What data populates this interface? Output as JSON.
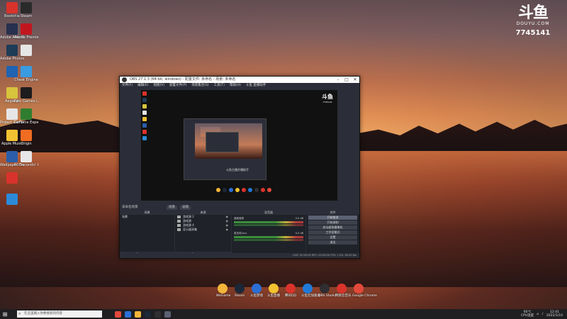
{
  "desktop": {
    "icons": [
      {
        "label": "Bootchia",
        "color": "#d9332b"
      },
      {
        "label": "Adobe After Effects",
        "color": "#27314f"
      },
      {
        "label": "Adobe Photoshop",
        "color": "#1e3c57"
      },
      {
        "label": "",
        "color": "#1f63b3"
      },
      {
        "label": "Aegisub",
        "color": "#d8c43d"
      },
      {
        "label": "Project Zomboid",
        "color": "#e6e6e6"
      },
      {
        "label": "Apple Music",
        "color": "#f1c232"
      },
      {
        "label": "Wallpaper Engine",
        "color": "#2a5ea8"
      },
      {
        "label": "",
        "color": "#d9332b"
      },
      {
        "label": "",
        "color": "#2c8ad8"
      },
      {
        "label": "Steam",
        "color": "#2a2a2a"
      },
      {
        "label": "Adobe Premiere Pro",
        "color": "#c2161f"
      },
      {
        "label": "",
        "color": "#e6e6e6"
      },
      {
        "label": "Cheat Engine",
        "color": "#3b9be0"
      },
      {
        "label": "Epic Games Launcher",
        "color": "#1c1c1c"
      },
      {
        "label": "GeForce Experience",
        "color": "#2f7d2f"
      },
      {
        "label": "Origin",
        "color": "#f06c21"
      },
      {
        "label": "60 Seconds! Reatomized",
        "color": "#e6e6e6"
      }
    ]
  },
  "watermark": {
    "logo": "斗鱼",
    "site": "DOUYU.COM",
    "room_id": "7745141"
  },
  "obs": {
    "title": "OBS 27.1.3 (64-bit, windows) - 配置文件: 未命名 - 场景: 未命名",
    "menu": [
      "文件(F)",
      "编辑(E)",
      "视图(V)",
      "配置文件(P)",
      "场景集合(S)",
      "工具(T)",
      "帮助(H)",
      "斗鱼 直播助手"
    ],
    "preview_watermark": "斗鱼",
    "preview_watermark_sub": "7745141",
    "preview_caption": "斗鱼主播开播助手",
    "scene_tab_label": "未命名场景",
    "scene_tab_buttons": [
      "场景",
      "滤镜"
    ],
    "docks": {
      "scenes": {
        "header": "场景",
        "items": [
          "场景"
        ]
      },
      "sources": {
        "header": "来源",
        "items": [
          "游戏源 2",
          "游戏源",
          "游戏源 4",
          "显示器采集"
        ]
      },
      "mixer": {
        "header": "混音器",
        "tracks": [
          {
            "name": "桌面音频",
            "value": "0.0 dB"
          },
          {
            "name": "麦克风/Aux",
            "value": "0.0 dB"
          }
        ]
      },
      "controls": {
        "header": "控件",
        "buttons": [
          "开始推流",
          "开始录制",
          "启动虚拟摄像机",
          "工作室模式",
          "设置",
          "退出"
        ]
      }
    },
    "footer_buttons": "+ − ⚙ ∧ ∨",
    "status": "LIVE: 00:00:00   REC: 00:00:00   CPU: 1.5%, 60.00 fps"
  },
  "launcher": [
    {
      "label": "WeGame",
      "color": "#f2b63a"
    },
    {
      "label": "Steam",
      "color": "#1b2838"
    },
    {
      "label": "斗鱼游戏",
      "color": "#2b6fd6"
    },
    {
      "label": "斗鱼直播",
      "color": "#f2c230"
    },
    {
      "label": "腾讯QQ",
      "color": "#d9332b"
    },
    {
      "label": "斗鱼云加速器",
      "color": "#1f7ad8"
    },
    {
      "label": "OBS Studio",
      "color": "#302e31"
    },
    {
      "label": "网易云音乐",
      "color": "#d9332b"
    },
    {
      "label": "Google Chrome",
      "color": "#e2493b"
    }
  ],
  "taskbar": {
    "search_placeholder": "在这里输入你要搜索的内容",
    "apps": [
      "#e2493b",
      "#2b6fd6",
      "#f2b63a",
      "#1b2838",
      "#302e31",
      "#5b6072"
    ],
    "weather_temp": "60℃",
    "weather_text": "CPU温度",
    "time": "12:41",
    "date": "2022/1/10"
  }
}
